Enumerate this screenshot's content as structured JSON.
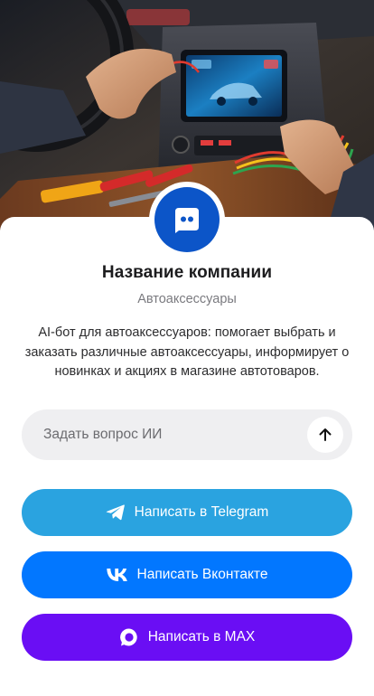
{
  "company": {
    "name": "Название компании",
    "category": "Автоаксессуары",
    "description": "AI-бот для автоаксессуаров: помогает выбрать и заказать различные автоаксессуары, информирует о новинках и акциях в магазине автотоваров."
  },
  "ask": {
    "placeholder": "Задать вопрос ИИ"
  },
  "actions": [
    {
      "label": "Написать в Telegram",
      "icon": "telegram-icon",
      "color": "#2aa3e0"
    },
    {
      "label": "Написать Вконтакте",
      "icon": "vk-icon",
      "color": "#0277ff"
    },
    {
      "label": "Написать в MAX",
      "icon": "max-icon",
      "color": "#6a0ef4"
    }
  ],
  "colors": {
    "logo": "#0c55c8",
    "input_bg": "#efeff1"
  }
}
